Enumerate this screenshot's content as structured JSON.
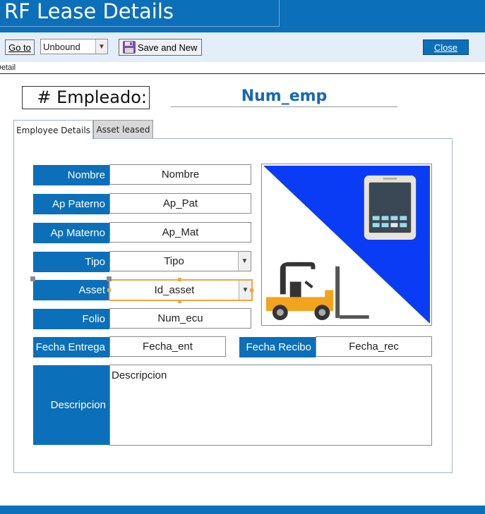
{
  "window": {
    "title": "RF Lease Details"
  },
  "toolbar": {
    "goto_label": "Go to",
    "record_select": "Unbound",
    "save_new_label": "Save and New",
    "close_label": "Close"
  },
  "section": {
    "detail_label": "Detail"
  },
  "employee": {
    "label": "# Empleado:",
    "value": "Num_emp"
  },
  "tabs": [
    {
      "label": "Employee Details",
      "selected": true
    },
    {
      "label": "Asset leased",
      "selected": false
    }
  ],
  "fields": {
    "nombre": {
      "label": "Nombre",
      "value": "Nombre"
    },
    "ap_paterno": {
      "label": "Ap Paterno",
      "value": "Ap_Pat"
    },
    "ap_materno": {
      "label": "Ap Materno",
      "value": "Ap_Mat"
    },
    "tipo": {
      "label": "Tipo",
      "value": "Tipo"
    },
    "asset": {
      "label": "Asset",
      "value": "Id_asset"
    },
    "folio": {
      "label": "Folio",
      "value": "Num_ecu"
    },
    "fecha_entrega": {
      "label": "Fecha Entrega",
      "value": "Fecha_ent"
    },
    "fecha_recibo": {
      "label": "Fecha Recibo",
      "value": "Fecha_rec"
    },
    "descripcion": {
      "label": "Descripcion",
      "value": "Descripcion"
    }
  },
  "colors": {
    "accent": "#0b6fb9",
    "selection": "#f0a640",
    "picture_blue": "#0a3cf5"
  },
  "icons": [
    "save-icon",
    "dropdown-arrow-icon",
    "forklift-icon",
    "tablet-icon"
  ]
}
